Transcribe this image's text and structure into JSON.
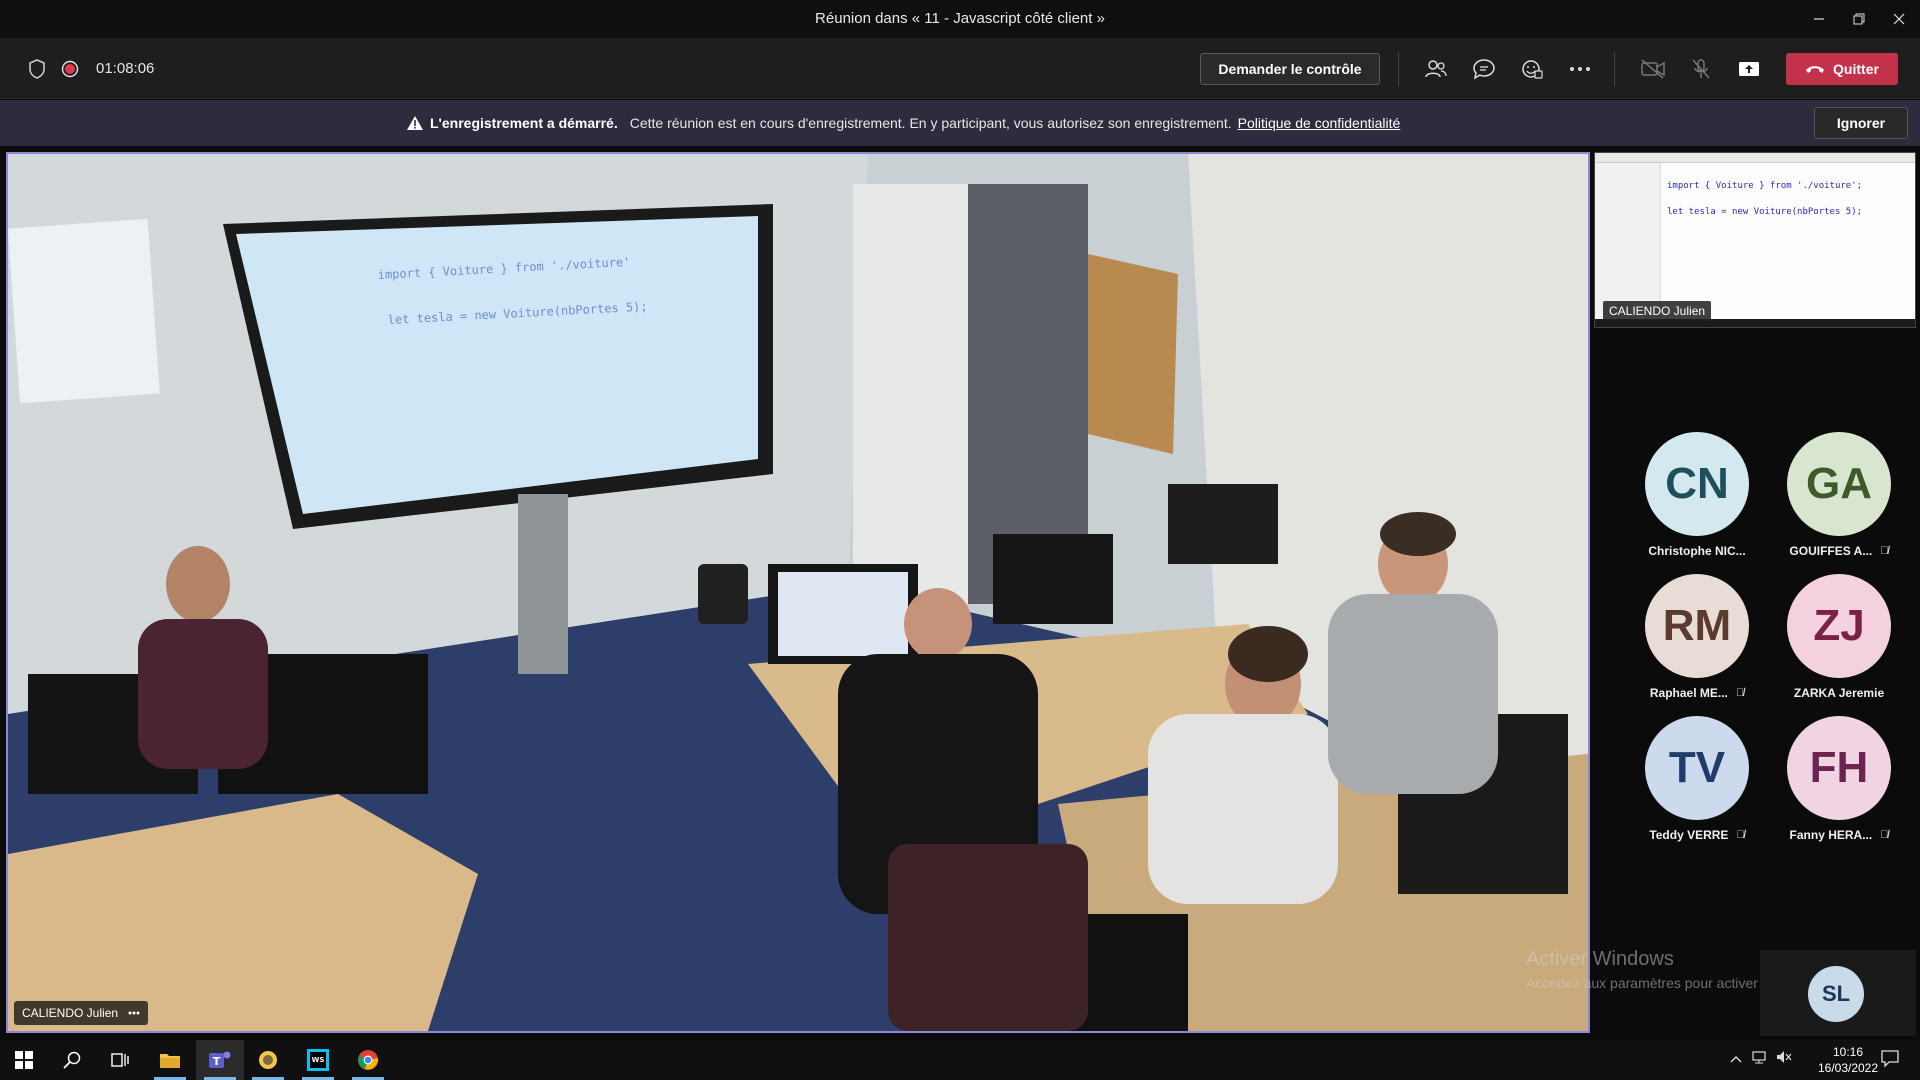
{
  "window": {
    "title": "Réunion dans « 11 - Javascript côté client »"
  },
  "toolbar": {
    "timer": "01:08:06",
    "request_control": "Demander le contrôle",
    "quit": "Quitter"
  },
  "banner": {
    "title": "L'enregistrement a démarré.",
    "message": "Cette réunion est en cours d'enregistrement. En y participant, vous autorisez son enregistrement.",
    "link": "Politique de confidentialité",
    "ignore": "Ignorer"
  },
  "stage": {
    "speaker": "CALIENDO Julien",
    "screen_code": [
      "import { Voiture } from './voiture'",
      "let tesla = new Voiture(nbPortes 5);"
    ]
  },
  "share": {
    "label": "CALIENDO Julien",
    "code_line1": "import { Voiture } from './voiture';",
    "code_line2": "let tesla = new Voiture(nbPortes 5);"
  },
  "participants": [
    {
      "initials": "CN",
      "name": "Christophe NIC...",
      "muted": false,
      "bg": "#d4e8ef",
      "fg": "#1f4f5c"
    },
    {
      "initials": "GA",
      "name": "GOUIFFES A...",
      "muted": true,
      "bg": "#d9e6cf",
      "fg": "#3e5a2a"
    },
    {
      "initials": "RM",
      "name": "Raphael ME...",
      "muted": true,
      "bg": "#e9dcd7",
      "fg": "#5b3a30"
    },
    {
      "initials": "ZJ",
      "name": "ZARKA Jeremie",
      "muted": false,
      "bg": "#f3d1de",
      "fg": "#7a2246"
    },
    {
      "initials": "TV",
      "name": "Teddy VERRE",
      "muted": true,
      "bg": "#cdd9ec",
      "fg": "#1f3c6b"
    },
    {
      "initials": "FH",
      "name": "Fanny HERA...",
      "muted": true,
      "bg": "#f1d4e4",
      "fg": "#6d2350"
    }
  ],
  "watermark": {
    "line1": "Activer Windows",
    "line2": "Accédez aux paramètres pour activer Windows."
  },
  "self": {
    "initials": "SL"
  },
  "taskbar": {
    "time": "10:16",
    "date": "16/03/2022"
  },
  "colors": {
    "quit": "#c4314b",
    "stage_border": "#8a87d4",
    "banner": "#2d2c3e"
  }
}
